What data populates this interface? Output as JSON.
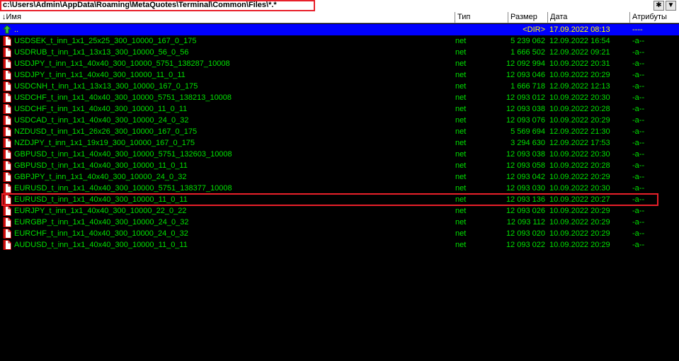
{
  "path": "c:\\Users\\Admin\\AppData\\Roaming\\MetaQuotes\\Terminal\\Common\\Files\\*.*",
  "toolbar": {
    "star_button": "✱",
    "dropdown_button": "▼"
  },
  "columns": {
    "name": "↓Имя",
    "type": "Тип",
    "size": "Размер",
    "date": "Дата",
    "attr": "Атрибуты"
  },
  "parent_row": {
    "name": "..",
    "type": "",
    "size": "<DIR>",
    "date": "17.09.2022 08:13",
    "attr": "----"
  },
  "files": [
    {
      "name": "USDSEK_t_inn_1x1_25x25_300_10000_167_0_175",
      "type": "net",
      "size": "5 239 062",
      "date": "12.09.2022 16:54",
      "attr": "-a--"
    },
    {
      "name": "USDRUB_t_inn_1x1_13x13_300_10000_56_0_56",
      "type": "net",
      "size": "1 666 502",
      "date": "12.09.2022 09:21",
      "attr": "-a--"
    },
    {
      "name": "USDJPY_t_inn_1x1_40x40_300_10000_5751_138287_10008",
      "type": "net",
      "size": "12 092 994",
      "date": "10.09.2022 20:31",
      "attr": "-a--"
    },
    {
      "name": "USDJPY_t_inn_1x1_40x40_300_10000_11_0_11",
      "type": "net",
      "size": "12 093 046",
      "date": "10.09.2022 20:29",
      "attr": "-a--"
    },
    {
      "name": "USDCNH_t_inn_1x1_13x13_300_10000_167_0_175",
      "type": "net",
      "size": "1 666 718",
      "date": "12.09.2022 12:13",
      "attr": "-a--"
    },
    {
      "name": "USDCHF_t_inn_1x1_40x40_300_10000_5751_138213_10008",
      "type": "net",
      "size": "12 093 012",
      "date": "10.09.2022 20:30",
      "attr": "-a--"
    },
    {
      "name": "USDCHF_t_inn_1x1_40x40_300_10000_11_0_11",
      "type": "net",
      "size": "12 093 038",
      "date": "10.09.2022 20:28",
      "attr": "-a--"
    },
    {
      "name": "USDCAD_t_inn_1x1_40x40_300_10000_24_0_32",
      "type": "net",
      "size": "12 093 076",
      "date": "10.09.2022 20:29",
      "attr": "-a--"
    },
    {
      "name": "NZDUSD_t_inn_1x1_26x26_300_10000_167_0_175",
      "type": "net",
      "size": "5 569 694",
      "date": "12.09.2022 21:30",
      "attr": "-a--"
    },
    {
      "name": "NZDJPY_t_inn_1x1_19x19_300_10000_167_0_175",
      "type": "net",
      "size": "3 294 630",
      "date": "12.09.2022 17:53",
      "attr": "-a--"
    },
    {
      "name": "GBPUSD_t_inn_1x1_40x40_300_10000_5751_132603_10008",
      "type": "net",
      "size": "12 093 038",
      "date": "10.09.2022 20:30",
      "attr": "-a--"
    },
    {
      "name": "GBPUSD_t_inn_1x1_40x40_300_10000_11_0_11",
      "type": "net",
      "size": "12 093 058",
      "date": "10.09.2022 20:28",
      "attr": "-a--"
    },
    {
      "name": "GBPJPY_t_inn_1x1_40x40_300_10000_24_0_32",
      "type": "net",
      "size": "12 093 042",
      "date": "10.09.2022 20:29",
      "attr": "-a--"
    },
    {
      "name": "EURUSD_t_inn_1x1_40x40_300_10000_5751_138377_10008",
      "type": "net",
      "size": "12 093 030",
      "date": "10.09.2022 20:30",
      "attr": "-a--"
    },
    {
      "name": "EURUSD_t_inn_1x1_40x40_300_10000_11_0_11",
      "type": "net",
      "size": "12 093 136",
      "date": "10.09.2022 20:27",
      "attr": "-a--"
    },
    {
      "name": "EURJPY_t_inn_1x1_40x40_300_10000_22_0_22",
      "type": "net",
      "size": "12 093 026",
      "date": "10.09.2022 20:29",
      "attr": "-a--"
    },
    {
      "name": "EURGBP_t_inn_1x1_40x40_300_10000_24_0_32",
      "type": "net",
      "size": "12 093 112",
      "date": "10.09.2022 20:29",
      "attr": "-a--"
    },
    {
      "name": "EURCHF_t_inn_1x1_40x40_300_10000_24_0_32",
      "type": "net",
      "size": "12 093 020",
      "date": "10.09.2022 20:29",
      "attr": "-a--"
    },
    {
      "name": "AUDUSD_t_inn_1x1_40x40_300_10000_11_0_11",
      "type": "net",
      "size": "12 093 022",
      "date": "10.09.2022 20:29",
      "attr": "-a--"
    }
  ],
  "colors": {
    "background": "#000000",
    "file_text": "#00e000",
    "selected_bg": "#0000ff",
    "selected_text": "#ffff00",
    "highlight_box": "#e8202a"
  }
}
